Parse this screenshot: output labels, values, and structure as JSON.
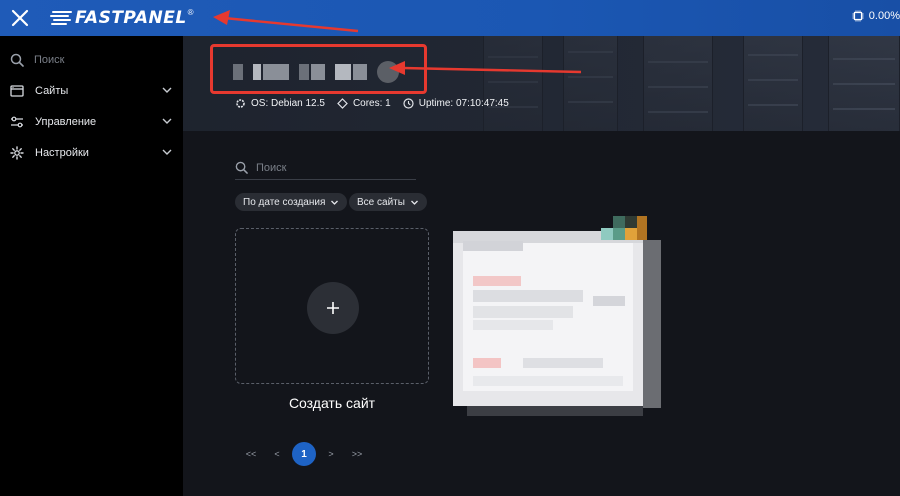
{
  "brand": {
    "name": "FASTPANEL",
    "reg": "®"
  },
  "topbar": {
    "status_value": "0.00%"
  },
  "sidebar": {
    "search_placeholder": "Поиск",
    "items": [
      {
        "label": "Сайты",
        "icon": "browser-window-icon"
      },
      {
        "label": "Управление",
        "icon": "sliders-icon"
      },
      {
        "label": "Настройки",
        "icon": "gear-icon"
      }
    ]
  },
  "server": {
    "os": "OS: Debian 12.5",
    "cores": "Cores: 1",
    "uptime": "Uptime: 07:10:47:45"
  },
  "main": {
    "search_placeholder": "Поиск",
    "filters": [
      {
        "label": "По дате создания"
      },
      {
        "label": "Все сайты"
      }
    ],
    "add_site_label": "Создать сайт",
    "pagination": {
      "first": "<<",
      "prev": "<",
      "current": "1",
      "next": ">",
      "last": ">>"
    }
  },
  "colors": {
    "topbar": "#1f5bb8",
    "sidebar": "#000000",
    "main_bg": "#13151b",
    "annotation_red": "#e6392f",
    "page_active": "#1e63c5"
  }
}
